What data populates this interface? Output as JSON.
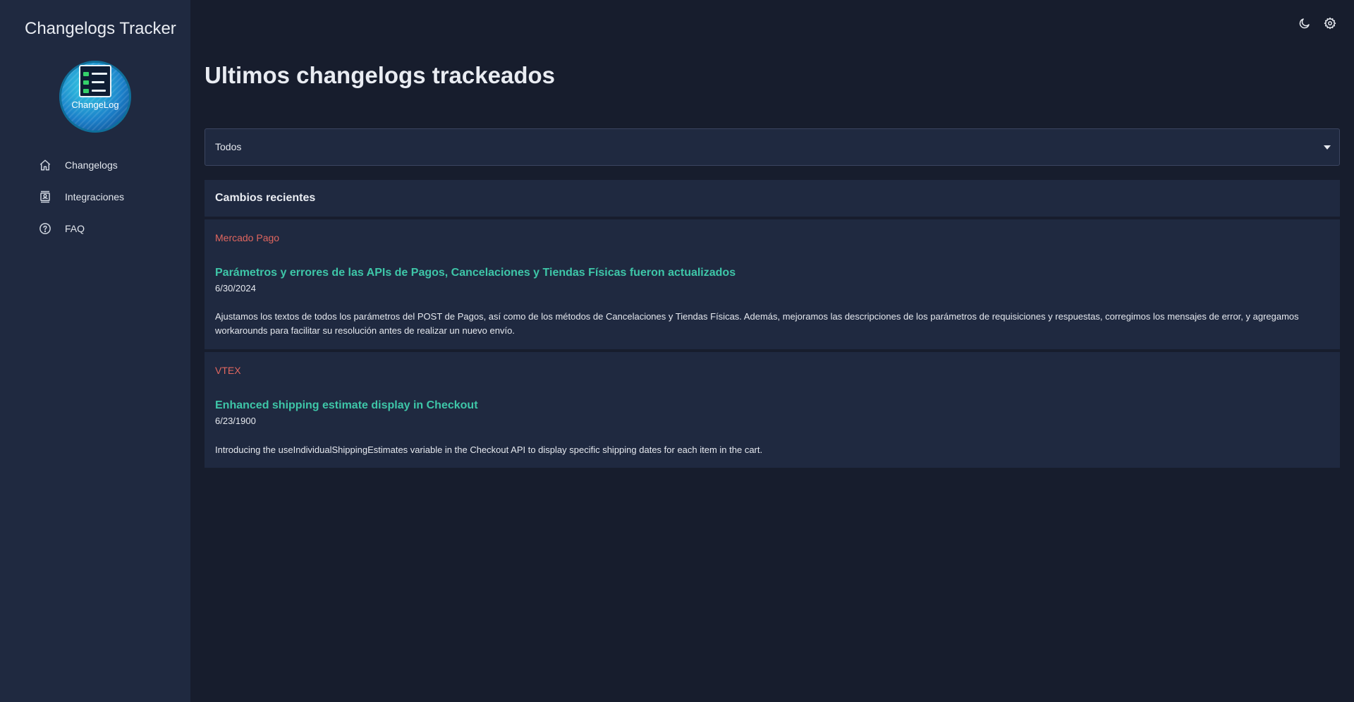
{
  "app": {
    "title": "Changelogs Tracker",
    "logo_text": "ChangeLog"
  },
  "sidebar": {
    "items": [
      {
        "label": "Changelogs",
        "icon": "home-icon"
      },
      {
        "label": "Integraciones",
        "icon": "contacts-icon"
      },
      {
        "label": "FAQ",
        "icon": "help-circle-icon"
      }
    ]
  },
  "toolbar": {
    "icons": [
      "moon-icon",
      "gear-icon"
    ]
  },
  "main": {
    "title": "Ultimos changelogs trackeados",
    "filter": {
      "selected": "Todos"
    },
    "section_title": "Cambios recientes",
    "entries": [
      {
        "source": "Mercado Pago",
        "title": "Parámetros y errores de las APIs de Pagos, Cancelaciones y Tiendas Físicas fueron actualizados",
        "date": "6/30/2024",
        "description": "Ajustamos los textos de todos los parámetros del POST de Pagos, así como de los métodos de Cancelaciones y Tiendas Físicas. Además, mejoramos las descripciones de los parámetros de requisiciones y respuestas, corregimos los mensajes de error, y agregamos workarounds para facilitar su resolución antes de realizar un nuevo envío."
      },
      {
        "source": "VTEX",
        "title": "Enhanced shipping estimate display in Checkout",
        "date": "6/23/1900",
        "description": "Introducing the useIndividualShippingEstimates variable in the Checkout API to display specific shipping dates for each item in the cart."
      }
    ]
  },
  "colors": {
    "background": "#171d2d",
    "panel": "#1f2940",
    "source_accent": "#e0665f",
    "title_accent": "#3ec6a8"
  }
}
